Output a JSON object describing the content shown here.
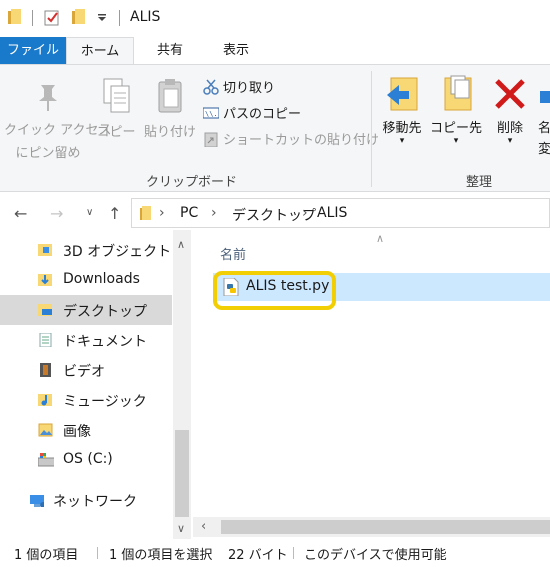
{
  "window": {
    "title": "ALIS"
  },
  "tabs": [
    {
      "label": "ファイル"
    },
    {
      "label": "ホーム"
    },
    {
      "label": "共有"
    },
    {
      "label": "表示"
    }
  ],
  "ribbon": {
    "clipboard": {
      "pin_label_1": "クイック アクセス",
      "pin_label_2": "にピン留め",
      "copy_label": "コピー",
      "paste_label": "貼り付け",
      "cut_label": "切り取り",
      "copy_path_label": "パスのコピー",
      "paste_shortcut_label": "ショートカットの貼り付け",
      "group_label": "クリップボード"
    },
    "organize": {
      "move_to_label": "移動先",
      "copy_to_label": "コピー先",
      "delete_label": "削除",
      "rename_label_partial": "名",
      "rename_label_partial2": "変",
      "group_label": "整理"
    }
  },
  "address": {
    "crumbs": [
      "PC",
      "デスクトップ",
      "ALIS"
    ]
  },
  "navpane": {
    "items": [
      {
        "label": "3D オブジェクト",
        "icon": "3d-objects-icon"
      },
      {
        "label": "Downloads",
        "icon": "downloads-icon"
      },
      {
        "label": "デスクトップ",
        "icon": "desktop-icon",
        "selected": true
      },
      {
        "label": "ドキュメント",
        "icon": "documents-icon"
      },
      {
        "label": "ビデオ",
        "icon": "videos-icon"
      },
      {
        "label": "ミュージック",
        "icon": "music-icon"
      },
      {
        "label": "画像",
        "icon": "pictures-icon"
      },
      {
        "label": "OS (C:)",
        "icon": "drive-icon"
      },
      {
        "label": "ネットワーク",
        "icon": "network-icon"
      }
    ]
  },
  "content": {
    "column_header": "名前",
    "files": [
      {
        "name": "ALIS test.py",
        "icon": "python-file-icon"
      }
    ]
  },
  "status": {
    "item_count": "1 個の項目",
    "selection": "1 個の項目を選択",
    "size": "22 バイト",
    "availability": "このデバイスで使用可能"
  },
  "colors": {
    "accent": "#1979ca",
    "selection": "#cce8ff",
    "highlight_ring": "#f2cf05",
    "folder": "#f8d775"
  }
}
